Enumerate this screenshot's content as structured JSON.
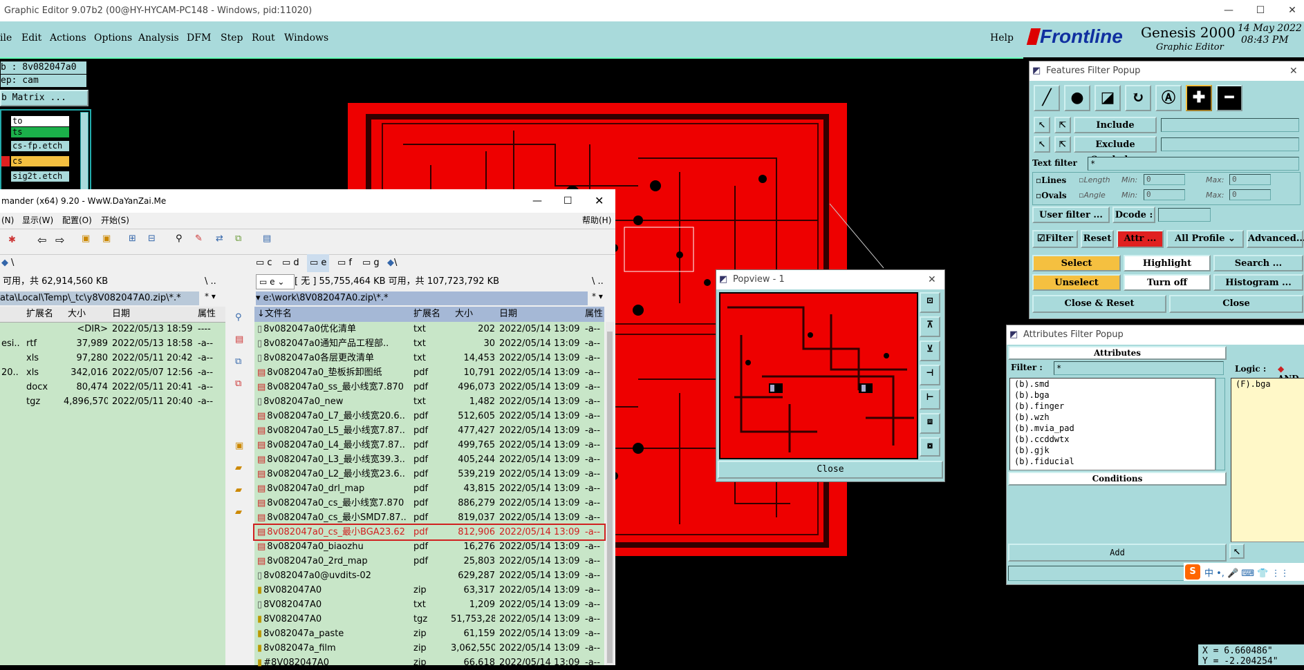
{
  "window": {
    "title": "Graphic Editor 9.07b2 (00@HY-HYCAM-PC148 - Windows, pid:11020)",
    "minimize": "—",
    "maximize": "☐",
    "close": "✕"
  },
  "menubar": {
    "items": [
      "ile",
      "Edit",
      "Actions",
      "Options",
      "Analysis",
      "DFM",
      "Step",
      "Rout",
      "Windows"
    ],
    "help": "Help"
  },
  "brand": {
    "logo": "Frontline",
    "product": "Genesis 2000",
    "subtitle": "Graphic Editor",
    "date": "14 May 2022",
    "time": "08:43 PM"
  },
  "job": {
    "job_label": "b : 8v082047a0",
    "step_label": "ep: cam",
    "matrix_button": "b Matrix ...",
    "layers": [
      "to",
      "ts",
      "cs-fp.etch",
      "cs",
      "sig2t.etch"
    ]
  },
  "tc": {
    "title": "mander (x64) 9.20 - WwW.DaYanZai.Me",
    "menu": [
      "(N)",
      "显示(W)",
      "配置(O)",
      "开始(S)"
    ],
    "help": "帮助(H)",
    "left_drive_path": "\\",
    "right_drives": [
      "c",
      "d",
      "e",
      "f",
      "g",
      "\\"
    ],
    "left_free": "可用，共 62,914,560 KB",
    "right_drive_select": "e",
    "right_free": "[ 无 ]  55,755,464 KB 可用，共 107,723,792 KB",
    "left_path": "ata\\Local\\Temp\\_tc\\y8V082047A0.zip\\*.*",
    "right_path": "e:\\work\\8V082047A0.zip\\*.*",
    "columns": {
      "name": "文件名",
      "ext": "扩展名",
      "size": "大小",
      "date": "日期",
      "attr": "属性"
    },
    "left_files": [
      {
        "name": "",
        "ext": "",
        "size": "<DIR>",
        "date": "2022/05/13 18:59",
        "attr": "----"
      },
      {
        "name": "esi..",
        "ext": "rtf",
        "size": "37,989",
        "date": "2022/05/13 18:58",
        "attr": "-a--"
      },
      {
        "name": "",
        "ext": "xls",
        "size": "97,280",
        "date": "2022/05/11 20:42",
        "attr": "-a--"
      },
      {
        "name": "20..",
        "ext": "xls",
        "size": "342,016",
        "date": "2022/05/07 12:56",
        "attr": "-a--"
      },
      {
        "name": "",
        "ext": "docx",
        "size": "80,474",
        "date": "2022/05/11 20:41",
        "attr": "-a--"
      },
      {
        "name": "",
        "ext": "tgz",
        "size": "4,896,570",
        "date": "2022/05/11 20:40",
        "attr": "-a--"
      }
    ],
    "right_files": [
      {
        "name": "8v082047a0优化清单",
        "ext": "txt",
        "size": "202",
        "date": "2022/05/14 13:09",
        "attr": "-a--",
        "icon": "txt"
      },
      {
        "name": "8v082047a0通知产品工程部..",
        "ext": "txt",
        "size": "30",
        "date": "2022/05/14 13:09",
        "attr": "-a--",
        "icon": "txt"
      },
      {
        "name": "8v082047a0各层更改清单",
        "ext": "txt",
        "size": "14,453",
        "date": "2022/05/14 13:09",
        "attr": "-a--",
        "icon": "txt"
      },
      {
        "name": "8v082047a0_垫板拆卸图纸",
        "ext": "pdf",
        "size": "10,791",
        "date": "2022/05/14 13:09",
        "attr": "-a--",
        "icon": "pdf"
      },
      {
        "name": "8v082047a0_ss_最小线宽7.870",
        "ext": "pdf",
        "size": "496,073",
        "date": "2022/05/14 13:09",
        "attr": "-a--",
        "icon": "pdf"
      },
      {
        "name": "8v082047a0_new",
        "ext": "txt",
        "size": "1,482",
        "date": "2022/05/14 13:09",
        "attr": "-a--",
        "icon": "txt"
      },
      {
        "name": "8v082047a0_L7_最小线宽20.6..",
        "ext": "pdf",
        "size": "512,605",
        "date": "2022/05/14 13:09",
        "attr": "-a--",
        "icon": "pdf"
      },
      {
        "name": "8v082047a0_L5_最小线宽7.87..",
        "ext": "pdf",
        "size": "477,427",
        "date": "2022/05/14 13:09",
        "attr": "-a--",
        "icon": "pdf"
      },
      {
        "name": "8v082047a0_L4_最小线宽7.87..",
        "ext": "pdf",
        "size": "499,765",
        "date": "2022/05/14 13:09",
        "attr": "-a--",
        "icon": "pdf"
      },
      {
        "name": "8v082047a0_L3_最小线宽39.3..",
        "ext": "pdf",
        "size": "405,244",
        "date": "2022/05/14 13:09",
        "attr": "-a--",
        "icon": "pdf"
      },
      {
        "name": "8v082047a0_L2_最小线宽23.6..",
        "ext": "pdf",
        "size": "539,219",
        "date": "2022/05/14 13:09",
        "attr": "-a--",
        "icon": "pdf"
      },
      {
        "name": "8v082047a0_drl_map",
        "ext": "pdf",
        "size": "43,815",
        "date": "2022/05/14 13:09",
        "attr": "-a--",
        "icon": "pdf"
      },
      {
        "name": "8v082047a0_cs_最小线宽7.870",
        "ext": "pdf",
        "size": "886,279",
        "date": "2022/05/14 13:09",
        "attr": "-a--",
        "icon": "pdf"
      },
      {
        "name": "8v082047a0_cs_最小SMD7.87..",
        "ext": "pdf",
        "size": "819,037",
        "date": "2022/05/14 13:09",
        "attr": "-a--",
        "icon": "pdf"
      },
      {
        "name": "8v082047a0_cs_最小BGA23.62",
        "ext": "pdf",
        "size": "812,906",
        "date": "2022/05/14 13:09",
        "attr": "-a--",
        "icon": "pdf",
        "selected": true
      },
      {
        "name": "8v082047a0_biaozhu",
        "ext": "pdf",
        "size": "16,276",
        "date": "2022/05/14 13:09",
        "attr": "-a--",
        "icon": "pdf"
      },
      {
        "name": "8v082047a0_2rd_map",
        "ext": "pdf",
        "size": "25,803",
        "date": "2022/05/14 13:09",
        "attr": "-a--",
        "icon": "pdf"
      },
      {
        "name": "8v082047a0@uvdits-02",
        "ext": "",
        "size": "629,287",
        "date": "2022/05/14 13:09",
        "attr": "-a--",
        "icon": "file"
      },
      {
        "name": "8V082047A0",
        "ext": "zip",
        "size": "63,317",
        "date": "2022/05/14 13:09",
        "attr": "-a--",
        "icon": "zip"
      },
      {
        "name": "8V082047A0",
        "ext": "txt",
        "size": "1,209",
        "date": "2022/05/14 13:09",
        "attr": "-a--",
        "icon": "txt"
      },
      {
        "name": "8V082047A0",
        "ext": "tgz",
        "size": "51,753,288",
        "date": "2022/05/14 13:09",
        "attr": "-a--",
        "icon": "zip"
      },
      {
        "name": "8v082047a_paste",
        "ext": "zip",
        "size": "61,159",
        "date": "2022/05/14 13:09",
        "attr": "-a--",
        "icon": "zip"
      },
      {
        "name": "8v082047a_film",
        "ext": "zip",
        "size": "3,062,550",
        "date": "2022/05/14 13:09",
        "attr": "-a--",
        "icon": "zip"
      },
      {
        "name": "#8V082047A0",
        "ext": "zip",
        "size": "66,618",
        "date": "2022/05/14 13:09",
        "attr": "-a--",
        "icon": "zip"
      }
    ]
  },
  "popview": {
    "title": "Popview - 1",
    "close_button": "Close"
  },
  "features_filter": {
    "title": "Features Filter Popup",
    "include_symbols": "Include Symbols :",
    "exclude_symbols": "Exclude Symbols :",
    "text_filter_label": "Text filter",
    "text_filter_value": "*",
    "lines": "Lines",
    "ovals": "Ovals",
    "length": "Length",
    "angle": "Angle",
    "min": "Min:",
    "max": "Max:",
    "min_val": "0",
    "max_val": "0",
    "user_filter": "User filter ...",
    "dcode": "Dcode :",
    "filter": "Filter",
    "reset": "Reset",
    "attr": "Attr ...",
    "profile": "All Profile",
    "advanced": "Advanced...",
    "select": "Select",
    "highlight": "Highlight",
    "search": "Search ...",
    "unselect": "Unselect",
    "turn_off": "Turn off",
    "histogram": "Histogram ...",
    "close_reset": "Close & Reset",
    "close": "Close"
  },
  "attributes_filter": {
    "title": "Attributes Filter Popup",
    "attributes_header": "Attributes",
    "filter_label": "Filter :",
    "filter_value": "*",
    "logic_label": "Logic :",
    "logic_value": "AND",
    "items": [
      "(b).smd",
      "(b).bga",
      "(b).finger",
      "(b).wzh",
      "(b).mvia_pad",
      "(b).ccddwtx",
      "(b).gjk",
      "(b).fiducial"
    ],
    "selected_items": [
      "(F).bga"
    ],
    "conditions": "Conditions",
    "add": "Add"
  },
  "ime": {
    "logo": "S",
    "text": "中 •, 🎤 ⌨ 👕 ⋮⋮"
  },
  "coords": {
    "x": "X = 6.660486\"",
    "y": "Y = -2.204254\""
  },
  "colors": {
    "teal": "#a9dadb",
    "board_red": "#e60000",
    "select_yellow": "#f5c040",
    "attr_red": "#e02020"
  }
}
